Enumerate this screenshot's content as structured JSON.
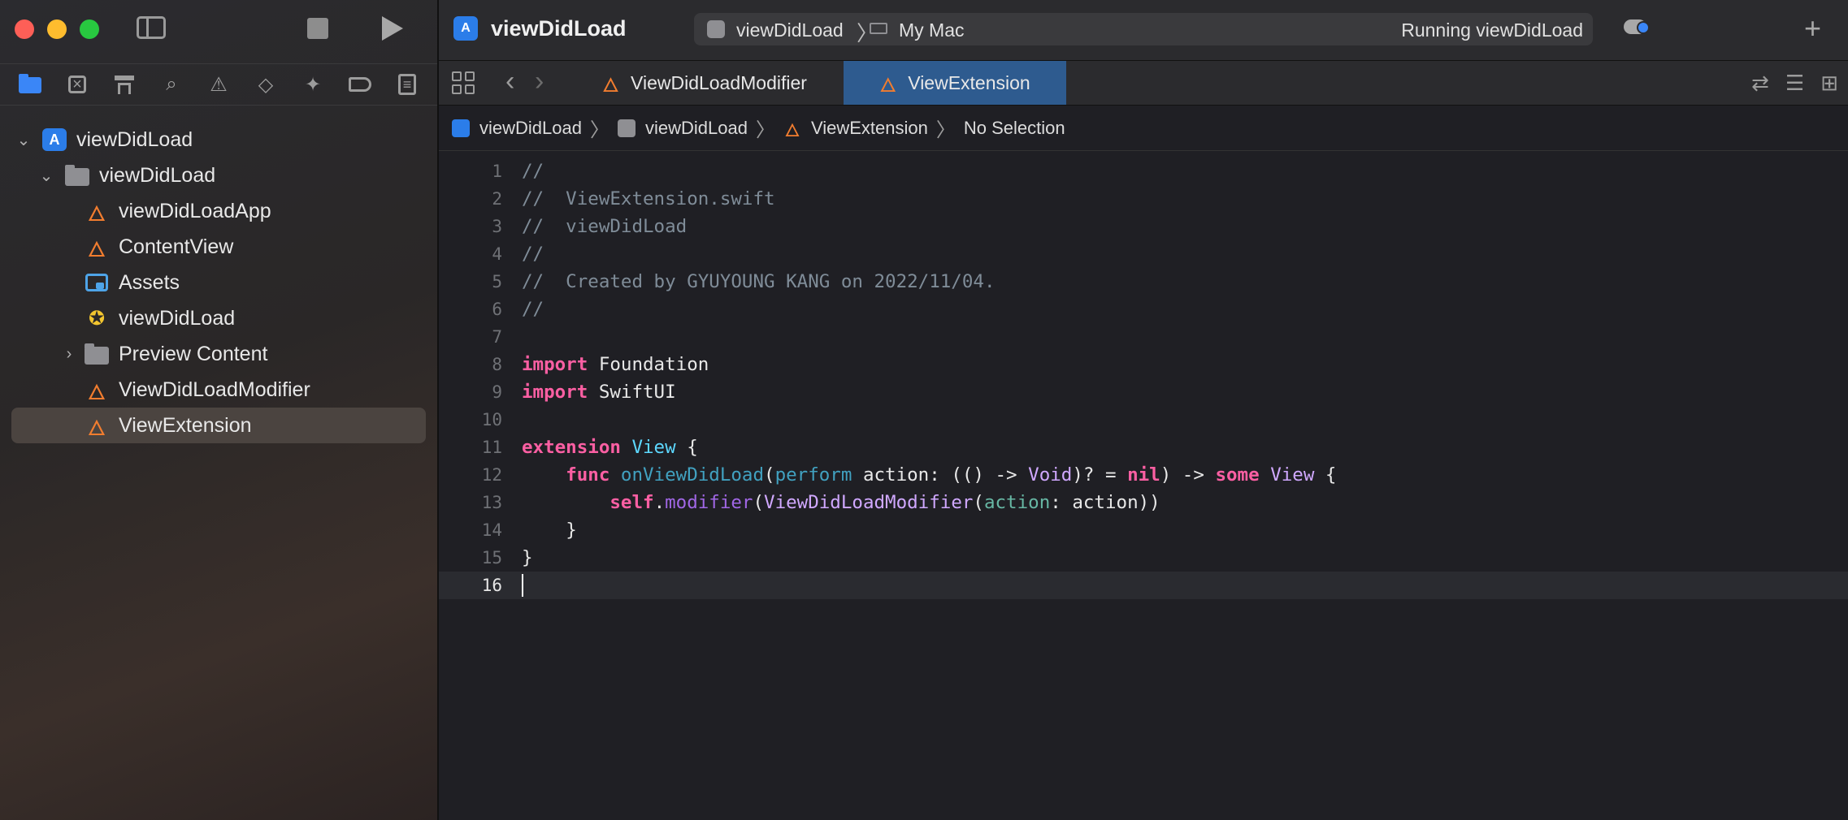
{
  "app": {
    "project_name": "viewDidLoad",
    "scheme": "viewDidLoad",
    "destination": "My Mac",
    "status": "Running viewDidLoad"
  },
  "navigator": {
    "icons": [
      "folder-icon",
      "source-control-icon",
      "symbol-icon",
      "find-icon",
      "issue-icon",
      "test-icon",
      "debug-icon",
      "breakpoint-icon",
      "report-icon"
    ],
    "tree": [
      {
        "label": "viewDidLoad",
        "icon": "project-icon",
        "level": 0,
        "expanded": true
      },
      {
        "label": "viewDidLoad",
        "icon": "folder-icon",
        "level": 1,
        "expanded": true
      },
      {
        "label": "viewDidLoadApp",
        "icon": "swift-file-icon",
        "level": 2
      },
      {
        "label": "ContentView",
        "icon": "swift-file-icon",
        "level": 2
      },
      {
        "label": "Assets",
        "icon": "assets-icon",
        "level": 2
      },
      {
        "label": "viewDidLoad",
        "icon": "entitlements-icon",
        "level": 2
      },
      {
        "label": "Preview Content",
        "icon": "folder-icon",
        "level": 2,
        "expanded": false
      },
      {
        "label": "ViewDidLoadModifier",
        "icon": "swift-file-icon",
        "level": 2
      },
      {
        "label": "ViewExtension",
        "icon": "swift-file-icon",
        "level": 2,
        "selected": true
      }
    ]
  },
  "tabs": [
    {
      "label": "ViewDidLoadModifier",
      "active": false
    },
    {
      "label": "ViewExtension",
      "active": true
    }
  ],
  "breadcrumb": [
    "viewDidLoad",
    "viewDidLoad",
    "ViewExtension",
    "No Selection"
  ],
  "editor": {
    "current_line": 16,
    "line_numbers": [
      "1",
      "2",
      "3",
      "4",
      "5",
      "6",
      "7",
      "8",
      "9",
      "10",
      "11",
      "12",
      "13",
      "14",
      "15",
      "16"
    ],
    "comments": {
      "l1": "//",
      "l2": "//  ViewExtension.swift",
      "l3": "//  viewDidLoad",
      "l4": "//",
      "l5": "//  Created by GYUYOUNG KANG on 2022/11/04.",
      "l6": "//"
    },
    "tokens": {
      "import": "import",
      "foundation": "Foundation",
      "swiftui": "SwiftUI",
      "extension": "extension",
      "view": "View",
      "open_brace": "{",
      "func": "func",
      "func_name": "onViewDidLoad",
      "perform": "perform",
      "action": "action",
      "void": "Void",
      "nil": "nil",
      "some": "some",
      "self": "self",
      "modifier": "modifier",
      "modifier_type": "ViewDidLoadModifier",
      "close_brace": "}"
    }
  },
  "colors": {
    "keyword": "#fc5fa3",
    "type": "#5dd8ff",
    "comment": "#7f8c98",
    "active_tab": "#2e5b8f",
    "swift_icon": "#f27d2f"
  }
}
